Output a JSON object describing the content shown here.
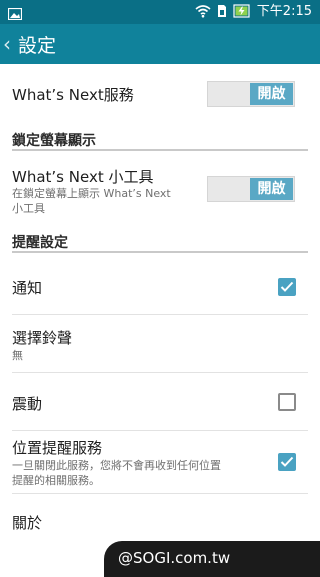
{
  "status_bar": {
    "time": "下午2:15"
  },
  "app_bar": {
    "back_glyph": "‹",
    "title": "設定"
  },
  "whats_next_service": {
    "label": "What’s Next服務",
    "toggle": "開啟"
  },
  "lock_screen_section": {
    "title": "鎖定螢幕顯示"
  },
  "whats_next_widget": {
    "label": "What’s Next 小工具",
    "subtitle_line1": "在鎖定螢幕上顯示 What’s Next",
    "subtitle_line2": "小工具",
    "toggle": "開啟"
  },
  "reminder_section": {
    "title": "提醒設定"
  },
  "notification": {
    "label": "通知",
    "checked": true
  },
  "ringtone": {
    "label": "選擇鈴聲",
    "value": "無"
  },
  "vibrate": {
    "label": "震動",
    "checked": false
  },
  "location_reminder": {
    "label": "位置提醒服務",
    "subtitle_line1": "一旦關閉此服務，您將不會再收到任何位置",
    "subtitle_line2": "提醒的相關服務。",
    "checked": true
  },
  "about": {
    "label": "關於"
  },
  "watermark": {
    "text": "@SOGI.com.tw"
  },
  "colors": {
    "status_bar": "#0a6f86",
    "app_bar": "#10829b",
    "toggle_on": "#5aa8c5",
    "checkbox": "#4aa2c2"
  }
}
